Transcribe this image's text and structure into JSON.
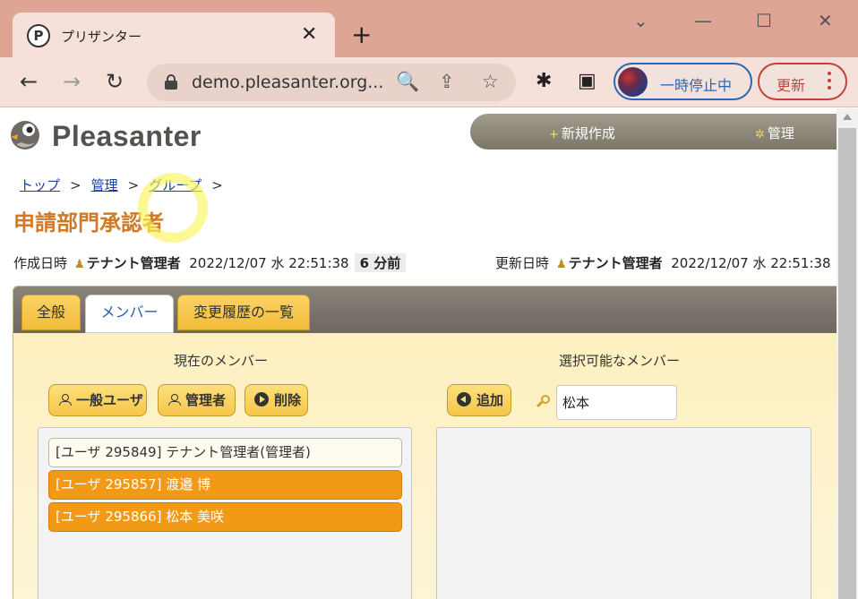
{
  "browser": {
    "tab_title": "プリザンター",
    "favicon_letter": "P",
    "close_glyph": "✕",
    "newtab_glyph": "+",
    "url": "demo.pleasanter.org...",
    "profile_label": "一時停止中",
    "update_label": "更新",
    "icons": {
      "back": "←",
      "forward": "→",
      "reload": "↻",
      "zoom": "🔍",
      "share": "⇪",
      "star": "☆",
      "extensions": "✱",
      "sidepanel": "▣",
      "minimize": "—",
      "maximize": "☐",
      "close": "✕",
      "tab_search": "⌄"
    }
  },
  "header": {
    "logo_text": "Pleasanter",
    "menu": [
      {
        "icon": "+",
        "label": "新規作成"
      },
      {
        "icon": "✲",
        "label": "管理"
      }
    ]
  },
  "breadcrumb": {
    "items": [
      "トップ",
      "管理",
      "グループ"
    ],
    "separator": ">"
  },
  "page_title": "申請部門承認者",
  "meta": {
    "created_label": "作成日時",
    "created_by": "テナント管理者",
    "created_at": "2022/12/07 水 22:51:38",
    "created_ago": "6 分前",
    "updated_label": "更新日時",
    "updated_by": "テナント管理者",
    "updated_at": "2022/12/07 水 22:51:38",
    "user_icon": "♟"
  },
  "tabs": [
    {
      "label": "全般",
      "active": false
    },
    {
      "label": "メンバー",
      "active": true
    },
    {
      "label": "変更履歴の一覧",
      "active": false
    }
  ],
  "members_panel": {
    "current_title": "現在のメンバー",
    "available_title": "選択可能なメンバー",
    "buttons": {
      "general_user": "一般ユーザ",
      "admin": "管理者",
      "delete": "削除",
      "add": "追加"
    },
    "search_value": "松本",
    "current_members": [
      {
        "text": "[ユーザ 295849] テナント管理者(管理者)",
        "selected": false
      },
      {
        "text": "[ユーザ 295857] 渡邉 博",
        "selected": true
      },
      {
        "text": "[ユーザ 295866] 松本 美咲",
        "selected": true
      }
    ],
    "available_members": []
  },
  "colors": {
    "title_orange": "#d07a27",
    "selected_orange": "#f29a17",
    "button_yellow": "#f6c64a",
    "chrome_frame": "#dea594",
    "link_blue": "#1a3fa6"
  }
}
